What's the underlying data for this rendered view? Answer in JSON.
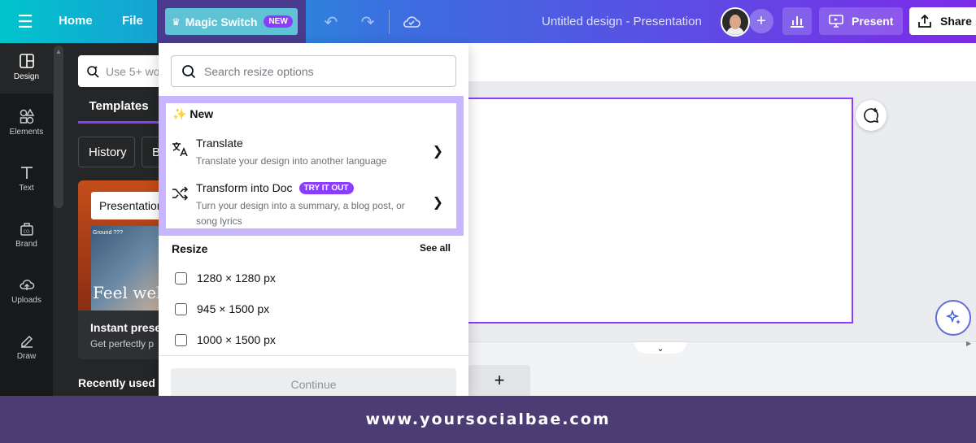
{
  "topbar": {
    "home_label": "Home",
    "file_label": "File",
    "magic_switch_label": "Magic Switch",
    "magic_switch_badge": "NEW",
    "doc_title": "Untitled design - Presentation",
    "present_label": "Present",
    "share_label": "Share",
    "gradient": [
      "#00c4cc",
      "#3b6fe0",
      "#7d2ae8"
    ]
  },
  "rail": {
    "items": [
      {
        "label": "Design",
        "icon": "layout-icon"
      },
      {
        "label": "Elements",
        "icon": "shapes-icon"
      },
      {
        "label": "Text",
        "icon": "text-icon"
      },
      {
        "label": "Brand",
        "icon": "brand-icon"
      },
      {
        "label": "Uploads",
        "icon": "cloud-upload-icon"
      },
      {
        "label": "Draw",
        "icon": "pen-icon"
      }
    ]
  },
  "panel": {
    "search_placeholder": "Use 5+ wo",
    "tab_label": "Templates",
    "chips": [
      "History",
      "B"
    ],
    "card": {
      "input_text": "Presentation",
      "photo_small_text": "Ground ???",
      "photo_text": "Feel well,",
      "title": "Instant prese",
      "subtitle": "Get perfectly p"
    },
    "recently_used": "Recently used"
  },
  "dropdown": {
    "search_placeholder": "Search resize options",
    "new_section_label": "New",
    "new_section_icon": "sparkles-icon",
    "options": [
      {
        "title": "Translate",
        "desc": "Translate your design into another language",
        "icon": "translate-icon"
      },
      {
        "title": "Transform into Doc",
        "badge": "TRY IT OUT",
        "desc": "Turn your design into a summary, a blog post, or song lyrics",
        "icon": "shuffle-icon"
      }
    ],
    "resize_label": "Resize",
    "see_all_label": "See all",
    "sizes": [
      "1280 × 1280 px",
      "945 × 1500 px",
      "1000 × 1500 px"
    ],
    "continue_label": "Continue",
    "highlight_color": "#c7b6ff",
    "accent_color": "#8b3dff"
  },
  "footer": {
    "text": "www.yoursocialbae.com"
  }
}
